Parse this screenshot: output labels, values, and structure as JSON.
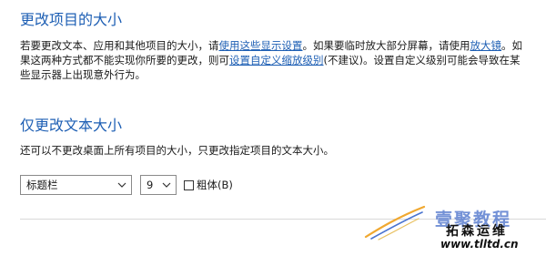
{
  "section1": {
    "title": "更改项目的大小",
    "line1_pre": "若要更改文本、应用和其他项目的大小，请",
    "line1_link1": "使用这些显示设置",
    "line1_mid": "。如果要临时放大部分屏幕，请使用",
    "line1_link2": "放大镜",
    "line1_post": "。如",
    "line2_pre": "果这两种方式都不能实现你所要的更改，则可",
    "line2_link": "设置自定义缩放级别",
    "line2_post": "(不建议)。设置自定义级别可能会导致在某",
    "line3": "些显示器上出现意外行为。"
  },
  "section2": {
    "title": "仅更改文本大小",
    "description": "还可以不更改桌面上所有项目的大小，只更改指定项目的文本大小。",
    "item_select": {
      "value": "标题栏",
      "icon": "chevron-down-icon"
    },
    "size_select": {
      "value": "9",
      "icon": "chevron-down-icon"
    },
    "bold_checkbox": {
      "label": "粗体(B)",
      "checked": false
    }
  },
  "watermark": {
    "line1": "壹聚教程",
    "line2": "拓森运维",
    "url": "www.tlltd.cn"
  },
  "colors": {
    "heading": "#1e5fb4",
    "link": "#1e5fb4",
    "text": "#1a1a1a",
    "divider": "#d9d9d9"
  }
}
